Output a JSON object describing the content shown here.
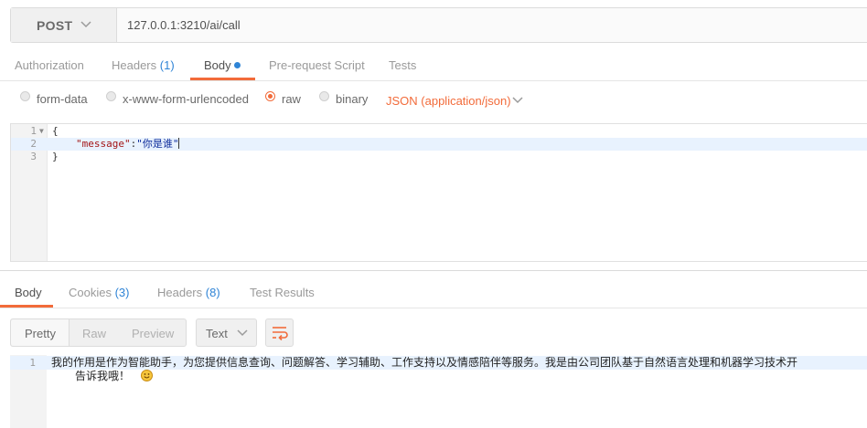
{
  "request": {
    "method": "POST",
    "url": "127.0.0.1:3210/ai/call"
  },
  "request_tabs": [
    {
      "label": "Authorization",
      "count": ""
    },
    {
      "label": "Headers",
      "count": "(1)"
    },
    {
      "label": "Body",
      "count": ""
    },
    {
      "label": "Pre-request Script",
      "count": ""
    },
    {
      "label": "Tests",
      "count": ""
    }
  ],
  "body_types": {
    "options": [
      "form-data",
      "x-www-form-urlencoded",
      "raw",
      "binary"
    ],
    "selected": "raw",
    "content_type": "JSON (application/json)"
  },
  "editor": {
    "line_numbers": [
      "1",
      "2",
      "3"
    ],
    "line1": "{",
    "line2_key": "\"message\"",
    "line2_colon": ":",
    "line2_value": "\"你是谁\"",
    "line3": "}"
  },
  "response_tabs": [
    {
      "label": "Body",
      "count": ""
    },
    {
      "label": "Cookies",
      "count": "(3)"
    },
    {
      "label": "Headers",
      "count": "(8)"
    },
    {
      "label": "Test Results",
      "count": ""
    }
  ],
  "response_view": {
    "modes": [
      "Pretty",
      "Raw",
      "Preview"
    ],
    "active_mode": "Pretty",
    "format": "Text"
  },
  "response_body": {
    "line_number": "1",
    "line1": "我的作用是作为智能助手，为您提供信息查询、问题解答、学习辅助、工作支持以及情感陪伴等服务。我是由公司团队基于自然语言处理和机器学习技术开",
    "line2": "告诉我哦！"
  },
  "colors": {
    "accent": "#f26b3a",
    "link": "#2f84d6"
  }
}
